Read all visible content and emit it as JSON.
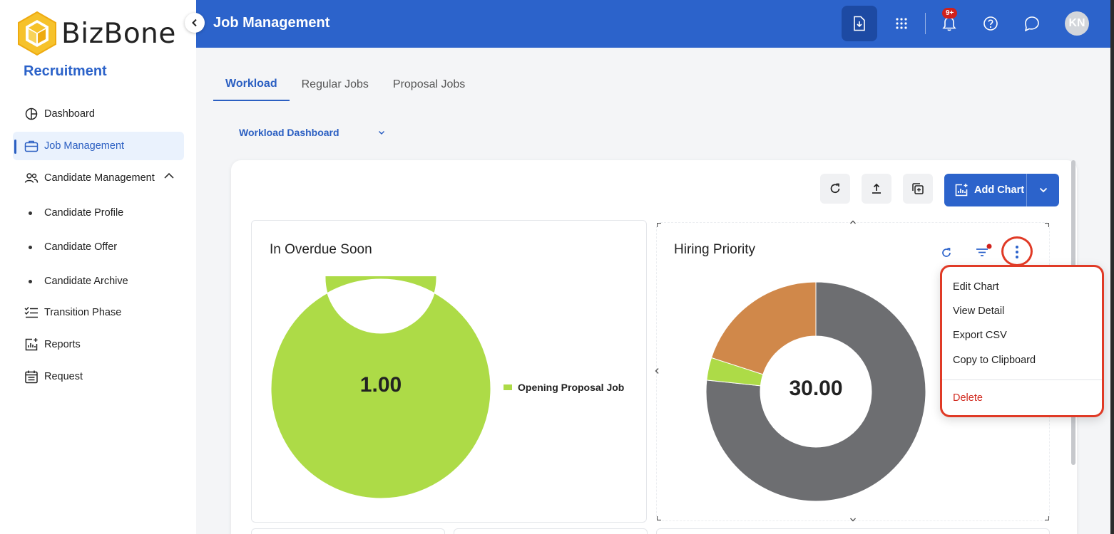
{
  "app": {
    "brand": "BizBone",
    "module": "Recruitment"
  },
  "sidebar": {
    "items": [
      {
        "label": "Dashboard",
        "icon": "pie-chart-icon"
      },
      {
        "label": "Job Management",
        "icon": "briefcase-icon",
        "active": true
      },
      {
        "label": "Candidate Management",
        "icon": "users-icon",
        "expanded": true
      },
      {
        "label": "Transition Phase",
        "icon": "checklist-icon"
      },
      {
        "label": "Reports",
        "icon": "report-chart-icon"
      },
      {
        "label": "Request",
        "icon": "calendar-list-icon"
      }
    ],
    "sub_items": [
      "Candidate Profile",
      "Candidate Offer",
      "Candidate Archive"
    ]
  },
  "header": {
    "title": "Job Management",
    "notification_badge": "9+",
    "avatar_initials": "KN"
  },
  "tabs": [
    "Workload",
    "Regular Jobs",
    "Proposal Jobs"
  ],
  "dashboard_select": "Workload Dashboard",
  "toolbar": {
    "add_chart_label": "Add Chart"
  },
  "charts": [
    {
      "title": "In Overdue Soon",
      "center_value": "1.00",
      "legend": [
        "Opening Proposal Job"
      ]
    },
    {
      "title": "Hiring Priority",
      "center_value": "30.00"
    }
  ],
  "chart_data": [
    {
      "type": "pie",
      "title": "In Overdue Soon",
      "categories": [
        "Opening Proposal Job"
      ],
      "values": [
        1
      ],
      "colors": [
        "#addb47"
      ]
    },
    {
      "type": "pie",
      "title": "Hiring Priority",
      "categories": [
        "",
        "",
        ""
      ],
      "values": [
        23,
        1,
        6
      ],
      "colors": [
        "#6d6e71",
        "#addb47",
        "#d0884a"
      ]
    }
  ],
  "menu": {
    "items": [
      "Edit Chart",
      "View Detail",
      "Export CSV",
      "Copy to Clipboard"
    ],
    "delete_label": "Delete"
  },
  "colors": {
    "primary": "#2c63cb",
    "accent_green": "#addb47",
    "accent_gray": "#6d6e71",
    "accent_orange": "#d0884a",
    "danger": "#d12a1f"
  }
}
